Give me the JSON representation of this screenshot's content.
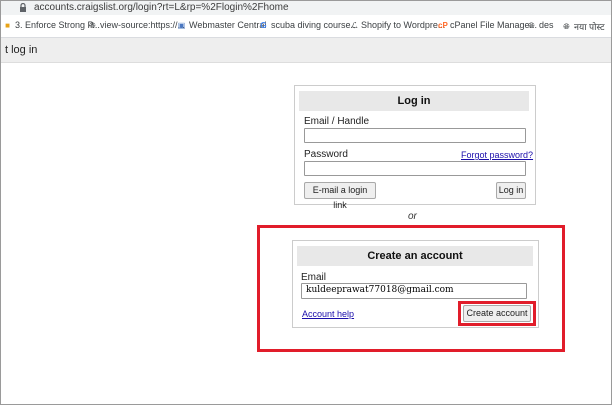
{
  "browser": {
    "url": "accounts.craigslist.org/login?rt=L&rp=%2Flogin%2Fhome",
    "bookmarks": [
      {
        "icon": "bookmark-icon",
        "label": "3. Enforce Strong P..."
      },
      {
        "icon": "globe-icon",
        "label": "view-source:https://..."
      },
      {
        "icon": "webmaster-icon",
        "label": "Webmaster Central"
      },
      {
        "icon": "google-icon",
        "label": "scuba diving course..."
      },
      {
        "icon": "script-icon",
        "label": "Shopify to Wordpre..."
      },
      {
        "icon": "cpanel-icon",
        "label": "cPanel File Manage..."
      },
      {
        "icon": "globe-icon",
        "label": "des"
      },
      {
        "icon": "globe-icon",
        "label": "नया पोस्ट"
      }
    ]
  },
  "header": {
    "title": "t log in"
  },
  "login": {
    "title": "Log in",
    "email_label": "Email / Handle",
    "password_label": "Password",
    "forgot_link": "Forgot password?",
    "email_link_button": "E-mail a login link",
    "login_button": "Log in"
  },
  "or_text": "or",
  "create": {
    "title": "Create an account",
    "email_label": "Email",
    "email_value": "kuldeeprawat77018@gmail.com",
    "help_link": "Account help",
    "create_button": "Create account"
  },
  "colors": {
    "highlight": "#e11d2a",
    "link": "#1a0dab"
  }
}
